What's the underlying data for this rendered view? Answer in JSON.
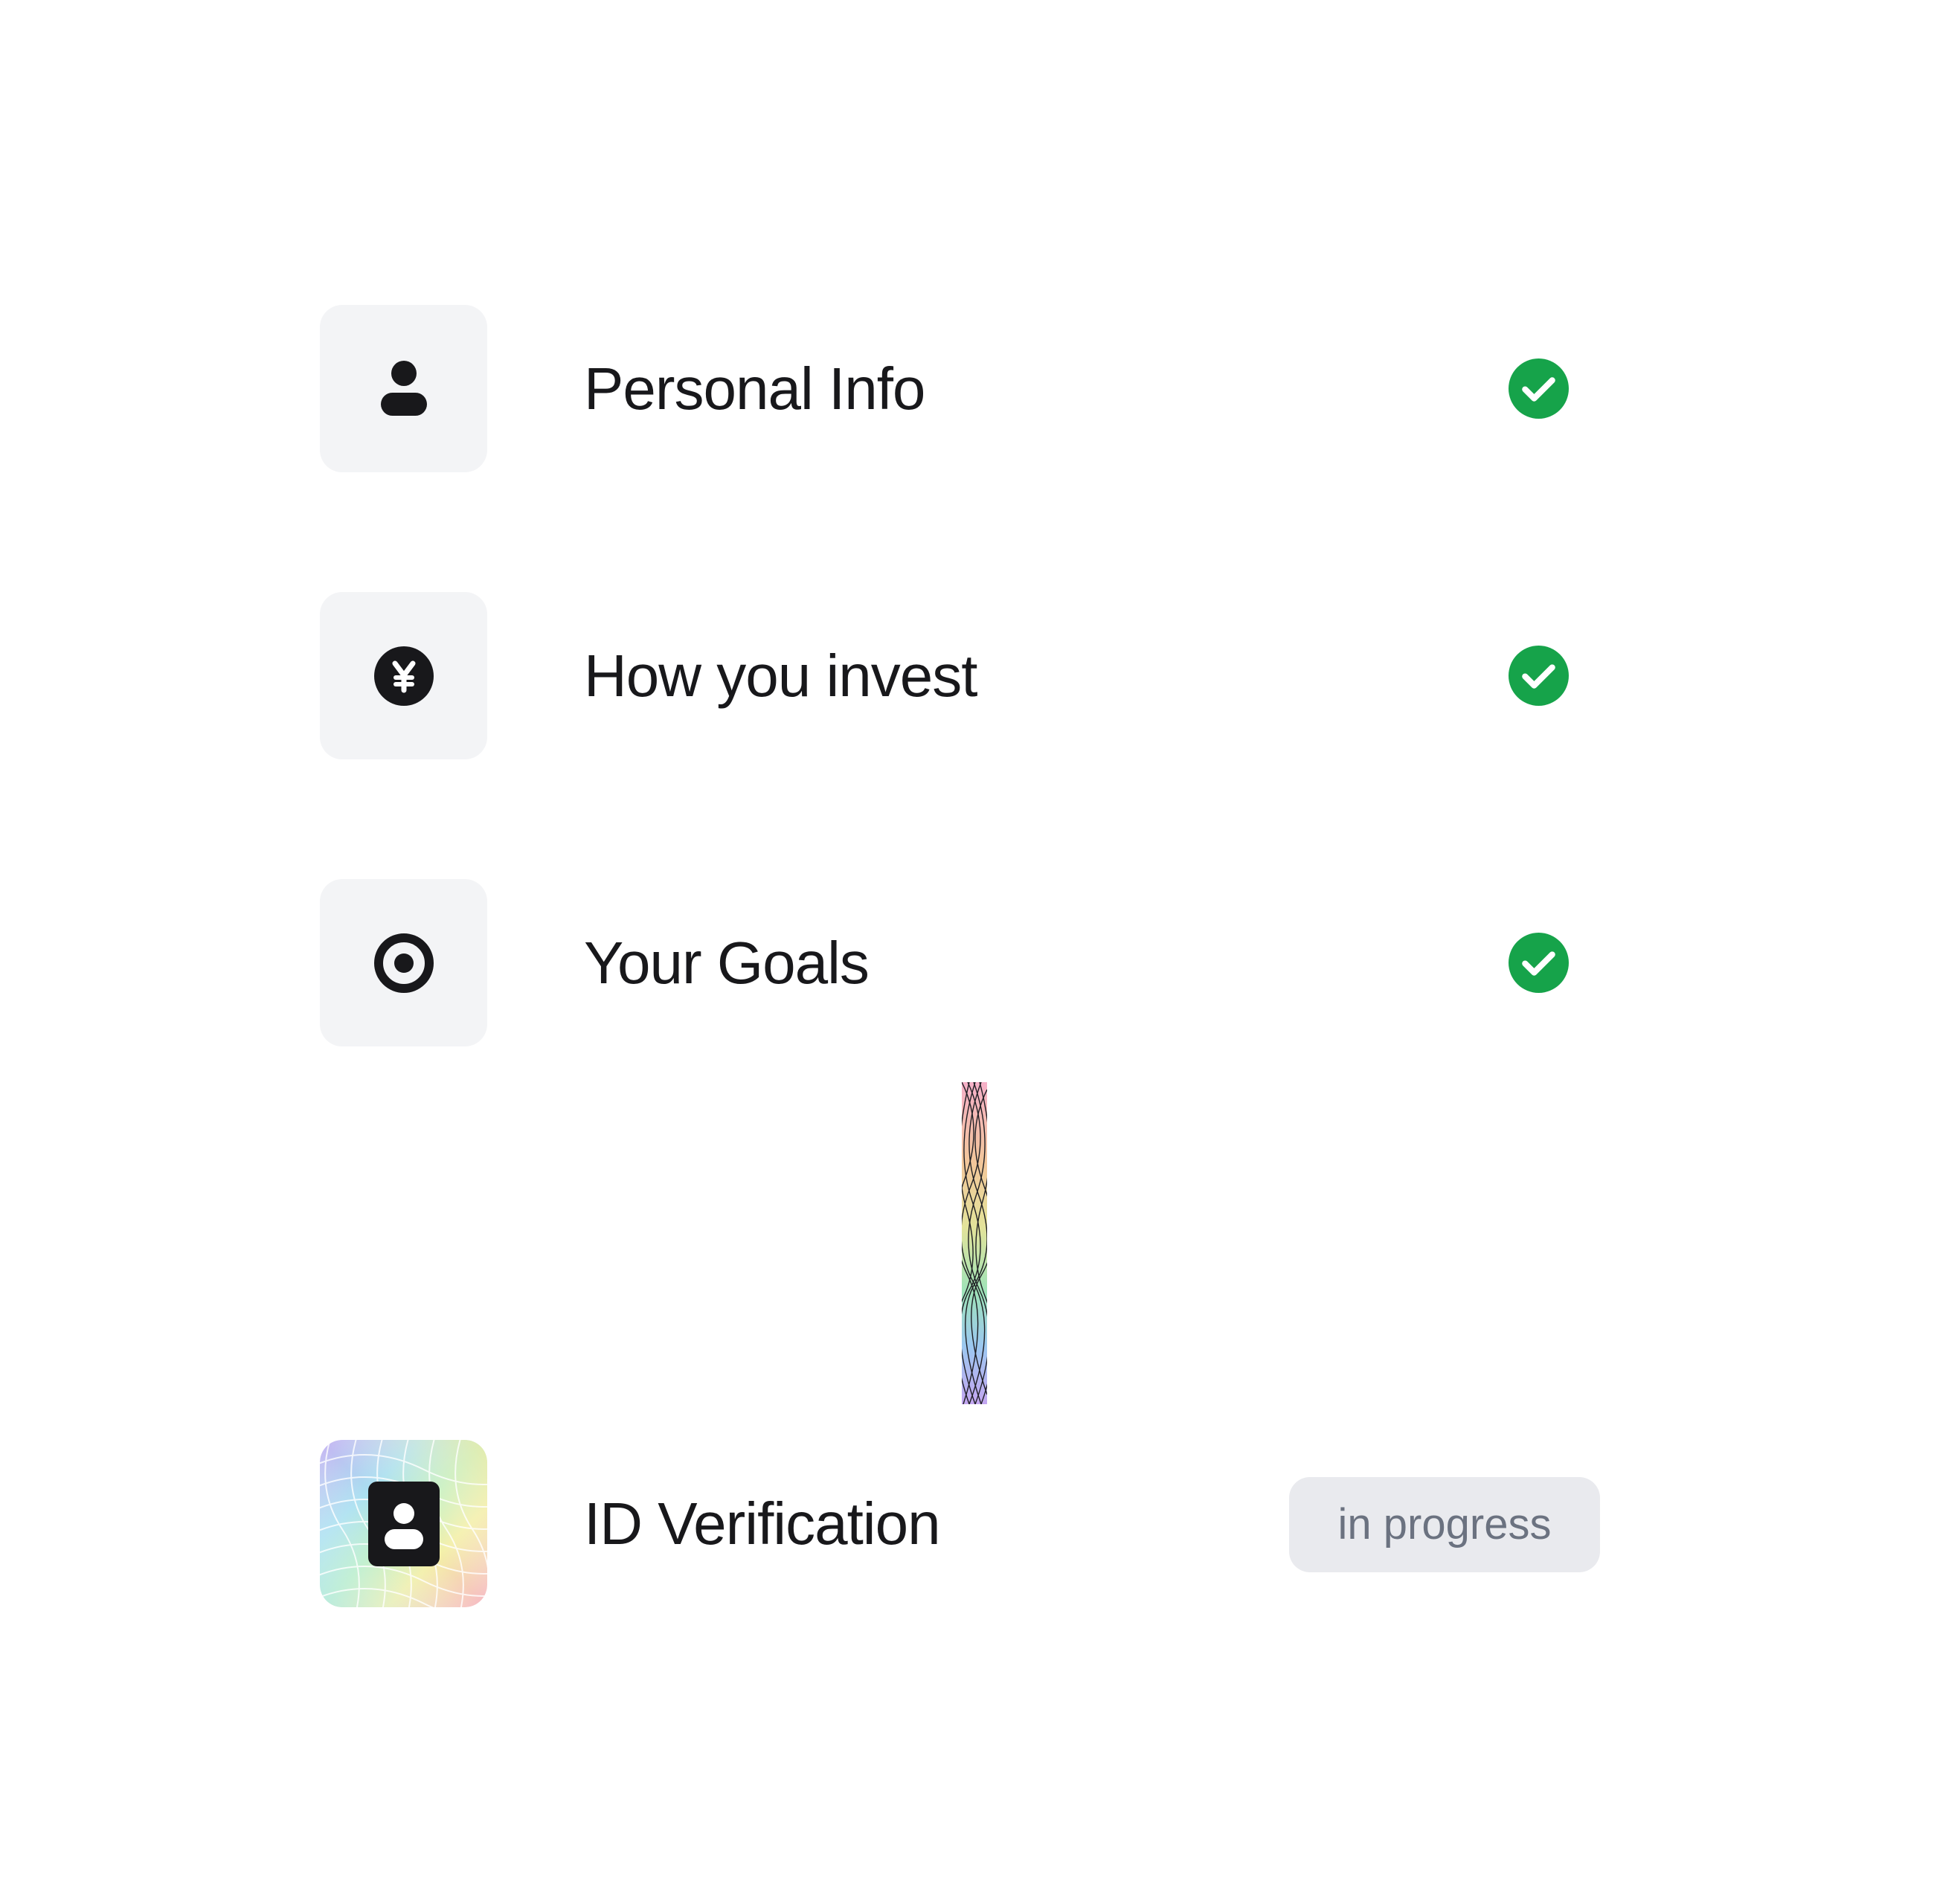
{
  "steps": [
    {
      "label": "Personal Info",
      "icon": "person-icon",
      "status": "complete"
    },
    {
      "label": "How you invest",
      "icon": "yen-coin-icon",
      "status": "complete"
    },
    {
      "label": "Your Goals",
      "icon": "target-icon",
      "status": "complete"
    },
    {
      "label": "ID Verification",
      "icon": "id-card-icon",
      "status": "in progress",
      "status_label": "in progress"
    }
  ],
  "colors": {
    "check_green": "#16a34a",
    "tile_bg": "#f3f4f6",
    "badge_bg": "#e9eaee",
    "badge_text": "#6b7280",
    "icon_dark": "#18181b"
  }
}
